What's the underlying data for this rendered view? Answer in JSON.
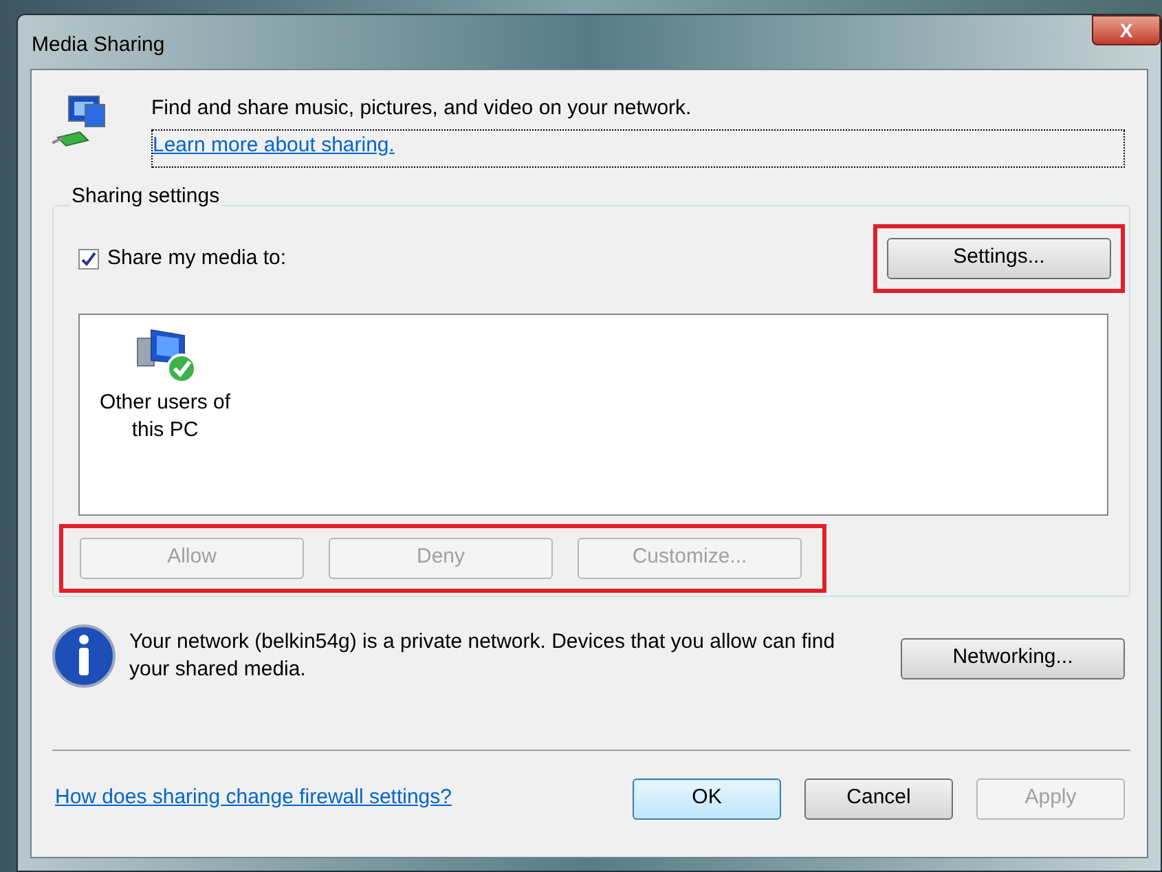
{
  "window": {
    "title": "Media Sharing",
    "close_label": "X"
  },
  "header": {
    "text": "Find and share music, pictures, and video on your network.",
    "link": "Learn more about sharing."
  },
  "sharing_settings": {
    "title": "Sharing settings",
    "share_checkbox": {
      "label": "Share my media to:",
      "checked": true
    },
    "settings_button": {
      "label": "Settings...",
      "disabled": false
    },
    "devices": [
      {
        "label": "Other users of this PC",
        "selected": false
      }
    ],
    "buttons": [
      {
        "label": "Allow",
        "disabled": true
      },
      {
        "label": "Deny",
        "disabled": true
      },
      {
        "label": "Customize...",
        "disabled": true
      }
    ]
  },
  "info": {
    "text": "Your network (belkin54g) is a private network. Devices that you allow can find your shared media.",
    "button": {
      "label": "Networking...",
      "disabled": false
    }
  },
  "footer": {
    "link": "How does sharing change firewall settings?",
    "buttons": [
      {
        "label": "OK",
        "disabled": false,
        "default": true
      },
      {
        "label": "Cancel",
        "disabled": false,
        "default": false
      },
      {
        "label": "Apply",
        "disabled": true,
        "default": false
      }
    ]
  }
}
